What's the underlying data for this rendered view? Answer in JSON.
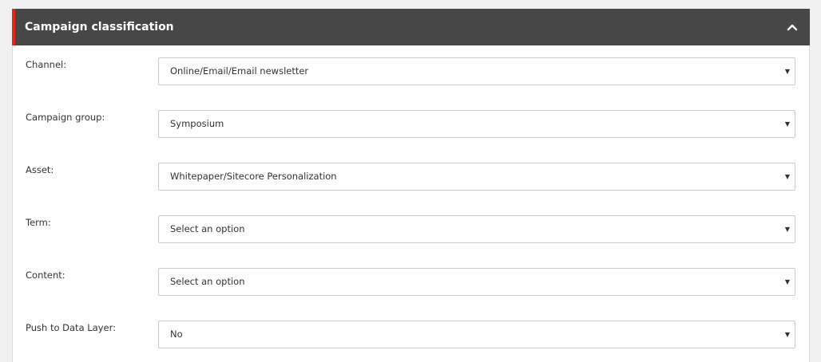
{
  "panel": {
    "title": "Campaign classification",
    "collapse_icon": "chevron-up-icon",
    "accent_color": "#dc291e",
    "header_color": "#474747"
  },
  "fields": [
    {
      "label": "Channel:",
      "value": "Online/Email/Email newsletter"
    },
    {
      "label": "Campaign group:",
      "value": "Symposium"
    },
    {
      "label": "Asset:",
      "value": "Whitepaper/Sitecore Personalization"
    },
    {
      "label": "Term:",
      "value": "Select an option"
    },
    {
      "label": "Content:",
      "value": "Select an option"
    },
    {
      "label": "Push to Data Layer:",
      "value": "No"
    }
  ],
  "dropdown_icon": "caret-down-icon"
}
